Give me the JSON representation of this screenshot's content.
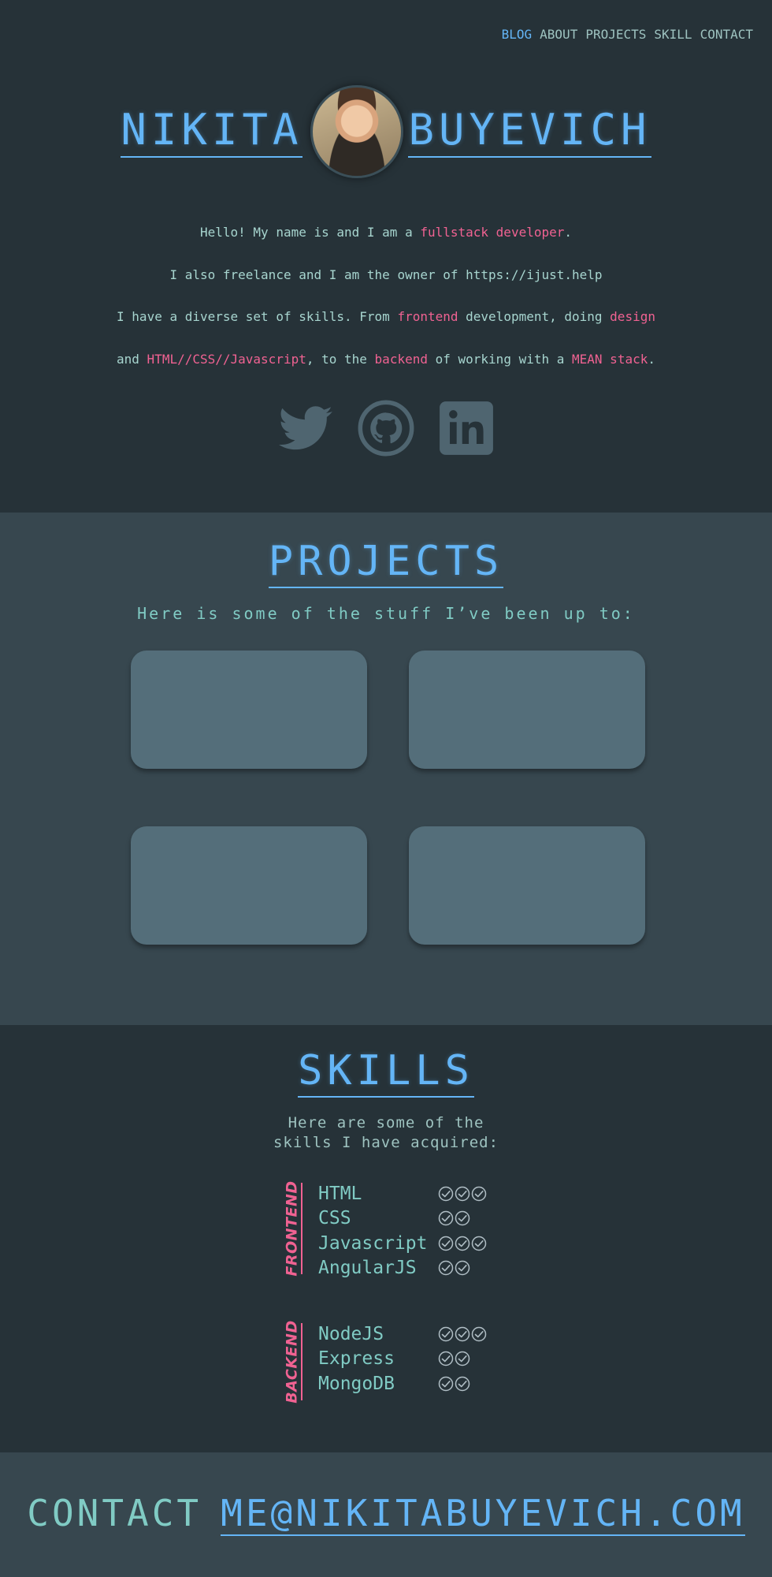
{
  "nav": {
    "items": [
      {
        "label": "BLOG",
        "active": true
      },
      {
        "label": "ABOUT",
        "active": false
      },
      {
        "label": "PROJECTS",
        "active": false
      },
      {
        "label": "SKILL",
        "active": false
      },
      {
        "label": "CONTACT",
        "active": false
      }
    ]
  },
  "hero": {
    "first_name": "NIKITA",
    "last_name": "BUYEVICH",
    "intro": {
      "line1": {
        "a": "Hello! My name is  and I am a ",
        "hl1": "fullstack developer",
        "b": "."
      },
      "line2": {
        "a": "I also freelance and I am the owner of https://ijust.help"
      },
      "line3": {
        "a": "I have a diverse set of skills. From ",
        "hl1": "frontend",
        "b": " development, doing ",
        "hl2": "design"
      },
      "line4": {
        "a": "and ",
        "hl1": "HTML//CSS//Javascript",
        "b": ", to the ",
        "hl2": "backend",
        "c": " of working with a ",
        "hl3": "MEAN stack",
        "d": "."
      }
    },
    "social": [
      "twitter-icon",
      "github-icon",
      "linkedin-icon"
    ]
  },
  "projects": {
    "title": "PROJECTS",
    "subtitle": "Here is some of the stuff I’ve been up to:"
  },
  "skills": {
    "title": "SKILLS",
    "subtitle_line1": "Here are some of the",
    "subtitle_line2": "skills I have acquired:",
    "groups": [
      {
        "label": "FRONTEND",
        "items": [
          {
            "name": "HTML",
            "level": 3
          },
          {
            "name": "CSS",
            "level": 2
          },
          {
            "name": "Javascript",
            "level": 3
          },
          {
            "name": "AngularJS",
            "level": 2
          }
        ]
      },
      {
        "label": "BACKEND",
        "items": [
          {
            "name": "NodeJS",
            "level": 3
          },
          {
            "name": "Express",
            "level": 2
          },
          {
            "name": "MongoDB",
            "level": 2
          }
        ]
      }
    ]
  },
  "contact": {
    "label": "CONTACT",
    "email": "ME@NIKITABUYEVICH.COM"
  },
  "colors": {
    "background_dark": "#263238",
    "background_mid": "#37474f",
    "card": "#546e7a",
    "accent_blue": "#64b5f6",
    "accent_teal": "#80cbc4",
    "accent_pink": "#f06292"
  }
}
